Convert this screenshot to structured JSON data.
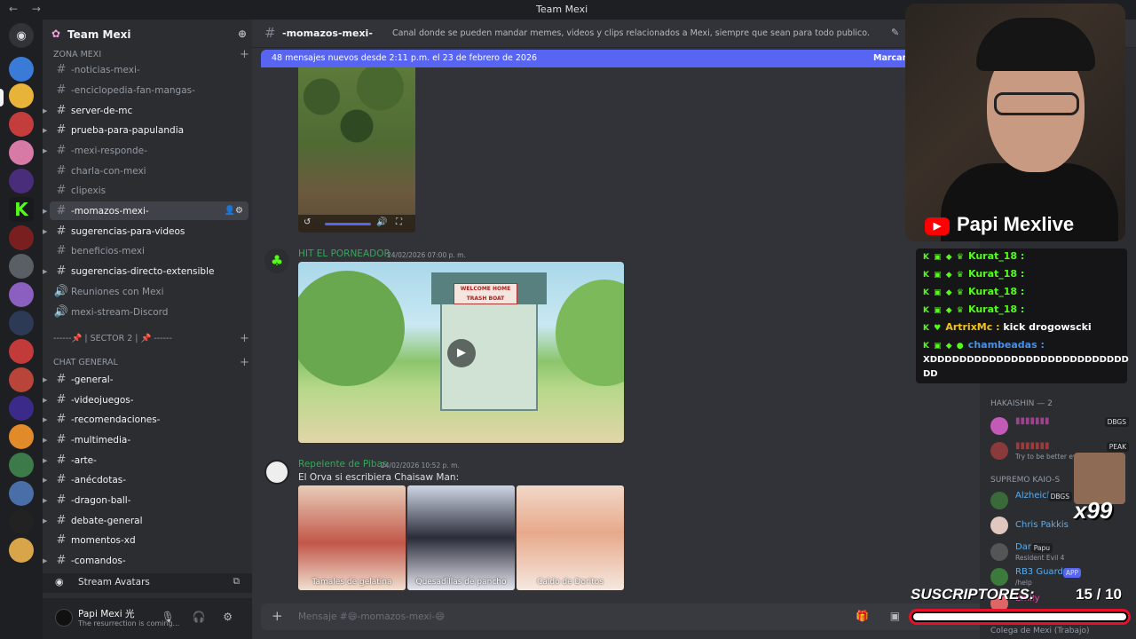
{
  "titlebar": {
    "title": "Team Mexi"
  },
  "guild": {
    "name": "Team Mexi"
  },
  "categories": [
    {
      "label": "ZONA MEXI"
    },
    {
      "label": "------📌 | SECTOR 2 | 📌 ------"
    },
    {
      "label": "CHAT GENERAL"
    }
  ],
  "channels": [
    {
      "name": "-noticias-mexi-"
    },
    {
      "name": "-enciclopedia-fan-mangas-"
    },
    {
      "name": "server-de-mc"
    },
    {
      "name": "prueba-para-papulandia"
    },
    {
      "name": "-mexi-responde-"
    },
    {
      "name": "charla-con-mexi"
    },
    {
      "name": "clipexis"
    },
    {
      "name": "-momazos-mexi-"
    },
    {
      "name": "sugerencias-para-videos"
    },
    {
      "name": "beneficios-mexi"
    },
    {
      "name": "sugerencias-directo-extensible"
    },
    {
      "name": "Reuniones con Mexi"
    },
    {
      "name": "mexi-stream-Discord"
    },
    {
      "name": "-general-"
    },
    {
      "name": "-videojuegos-"
    },
    {
      "name": "-recomendaciones-"
    },
    {
      "name": "-multimedia-"
    },
    {
      "name": "-arte-"
    },
    {
      "name": "-anécdotas-"
    },
    {
      "name": "-dragon-ball-"
    },
    {
      "name": "debate-general"
    },
    {
      "name": "momentos-xd"
    },
    {
      "name": "-comandos-"
    }
  ],
  "stream_bar": {
    "label": "Stream Avatars"
  },
  "user": {
    "name": "Papi Mexi 光",
    "status": "The resurrection is coming..."
  },
  "chat": {
    "channel": "-momazos-mexi-",
    "topic": "Canal donde se pueden mandar memes, videos y clips relacionados a Mexi, siempre que sean para todo publico.",
    "new_messages": "48 mensajes nuevos desde 2:11 p.m. el 23 de febrero de 2026",
    "mark_read": "Marcar c",
    "placeholder": "Mensaje #😄-momazos-mexi-😄"
  },
  "messages": [
    {
      "author": "HIT EL PORNEADOR",
      "timestamp": "24/02/2026 07:00 p. m.",
      "author_color": "#3ba55c"
    },
    {
      "author": "Repelente de Pibas",
      "timestamp": "24/02/2026 10:52 p. m.",
      "text": "El Orva si escribiera Chaisaw Man:",
      "author_color": "#3ba55c"
    }
  ],
  "video2": {
    "sign_line1": "WELCOME HOME",
    "sign_line2": "TRASH BOAT"
  },
  "image_captions": [
    "Tamales de gelatina",
    "Quesadillas de pancho",
    "Caldo de Doritos"
  ],
  "overlay": {
    "brand": "Papi Mexlive",
    "kick_chat": [
      {
        "user": "Kurat_18 :",
        "color": "#53fc18",
        "text": ""
      },
      {
        "user": "Kurat_18 :",
        "color": "#53fc18",
        "text": ""
      },
      {
        "user": "Kurat_18 :",
        "color": "#53fc18",
        "text": ""
      },
      {
        "user": "Kurat_18 :",
        "color": "#53fc18",
        "text": ""
      },
      {
        "user": "ArtrixMc :",
        "color": "#f0c419",
        "text": "kick drogowscki"
      },
      {
        "user": "chambeadas :",
        "color": "#4a90e2",
        "text": ""
      }
    ],
    "kick_msg_line1": "XDDDDDDDDDDDDDDDDDDDDDDDDDDD",
    "kick_msg_line2": "DD",
    "subs_label": "SUSCRIPTORES:",
    "subs_count": "15",
    "subs_goal": "/ 10",
    "subs_progress": 1.0,
    "x99": "x99"
  },
  "members": {
    "cat1": "HAKAISHIN",
    "cat1_count": "— 2",
    "cat2": "SUPREMO KAIO-S",
    "list": [
      {
        "name": "Alzheicky",
        "color": "#5dadec",
        "tag": "DBGS",
        "sub": ""
      },
      {
        "name": "Chris Pakkis",
        "color": "#5dadec",
        "tag": "",
        "sub": ""
      },
      {
        "name": "Dan",
        "color": "#5dadec",
        "tag": "Papu",
        "sub": "Resident Evil 4"
      },
      {
        "name": "RB3 Guard",
        "color": "#5dadec",
        "tag": "APP",
        "sub": "/help"
      },
      {
        "name": "Emily",
        "color": "#eb459e",
        "tag": "",
        "sub": ""
      }
    ],
    "hak1_sub": "Try to be better every...",
    "hak1_tag": "DBGS",
    "hak2_tag": "PEAK",
    "footer": "Colega de Mexi (Trabajo)"
  }
}
